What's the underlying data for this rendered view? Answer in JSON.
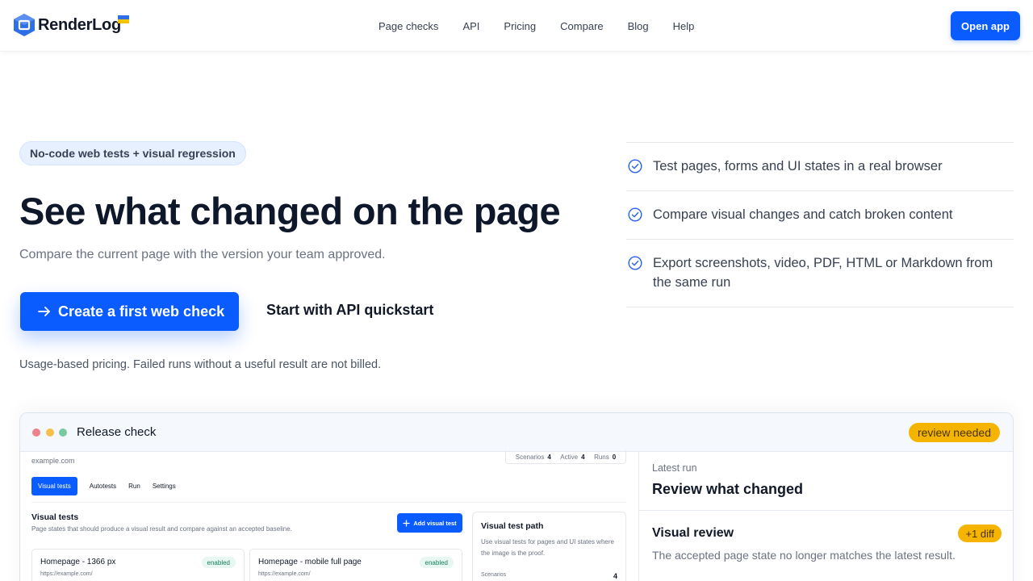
{
  "header": {
    "brand": "RenderLog",
    "nav": [
      "Page checks",
      "API",
      "Pricing",
      "Compare",
      "Blog",
      "Help"
    ],
    "open_app": "Open app"
  },
  "hero": {
    "badge": "No-code web tests + visual regression",
    "title": "See what changed on the page",
    "subtitle": "Compare the current page with the version your team approved.",
    "cta_primary": "Create a first web check",
    "cta_secondary": "Start with API quickstart",
    "pricing_note": "Usage-based pricing. Failed runs without a useful result are not billed."
  },
  "features": [
    "Test pages, forms and UI states in a real browser",
    "Compare visual changes and catch broken content",
    "Export screenshots, video, PDF, HTML or Markdown from the same run"
  ],
  "preview": {
    "window_title": "Release check",
    "status_pill": "review needed",
    "site": "example.com",
    "stats": [
      {
        "label": "Scenarios",
        "value": "4"
      },
      {
        "label": "Active",
        "value": "4"
      },
      {
        "label": "Runs",
        "value": "0"
      }
    ],
    "tabs": [
      "Visual tests",
      "Autotests",
      "Run",
      "Settings"
    ],
    "visual_tests_title": "Visual tests",
    "visual_tests_desc": "Page states that should produce a visual result and compare against an accepted baseline.",
    "add_button": "Add visual test",
    "cards": [
      {
        "title": "Homepage - 1366 px",
        "url": "https://example.com/",
        "badge": "enabled"
      },
      {
        "title": "Homepage - mobile full page",
        "url": "https://example.com/",
        "badge": "enabled"
      }
    ],
    "path": {
      "title": "Visual test path",
      "desc": "Use visual tests for pages and UI states where the image is the proof.",
      "label": "Scenarios",
      "value": "4"
    },
    "latest_run": {
      "label": "Latest run",
      "title": "Review what changed",
      "review_title": "Visual review",
      "diff_pill": "+1 diff",
      "review_desc": "The accepted page state no longer matches the latest result."
    }
  },
  "colors": {
    "accent": "#0b5cff",
    "warning": "#f5b400",
    "success_text": "#16815a"
  },
  "icons": {
    "logo": "cube-logo-icon",
    "flag": "ukraine-flag-icon",
    "arrow": "arrow-right-icon",
    "check": "check-circle-icon",
    "plus": "plus-icon"
  }
}
